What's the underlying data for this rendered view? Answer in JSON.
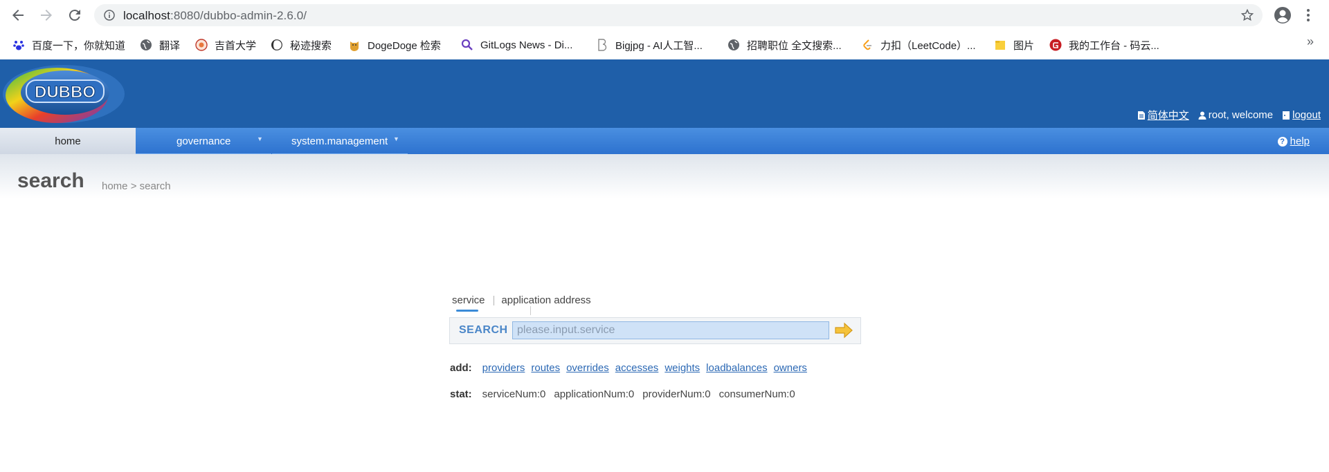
{
  "browser": {
    "url_host": "localhost",
    "url_path": ":8080/dubbo-admin-2.6.0/",
    "bookmarks": [
      {
        "label": "百度一下，你就知道",
        "icon": "baidu-paw-icon",
        "color": "#2932e1"
      },
      {
        "label": "翻译",
        "icon": "globe-icon",
        "color": "#5f6368"
      },
      {
        "label": "吉首大学",
        "icon": "university-seal-icon",
        "color": "#c0392b"
      },
      {
        "label": "秘迹搜索",
        "icon": "mijisou-icon",
        "color": "#333333"
      },
      {
        "label": "DogeDoge 检索",
        "icon": "doge-icon",
        "color": "#e0a030"
      },
      {
        "label": "GitLogs News - Di...",
        "icon": "magnifier-icon",
        "color": "#6a3fbf"
      },
      {
        "label": "Bigjpg - AI人工智...",
        "icon": "bigjpg-b-icon",
        "color": "#888888"
      },
      {
        "label": "招聘职位 全文搜索...",
        "icon": "globe-icon",
        "color": "#5f6368"
      },
      {
        "label": "力扣（LeetCode）...",
        "icon": "leetcode-icon",
        "color": "#f89f1b"
      },
      {
        "label": "图片",
        "icon": "folder-icon",
        "color": "#f9cf3b"
      },
      {
        "label": "我的工作台 - 码云...",
        "icon": "gitee-icon",
        "color": "#c71d23"
      }
    ],
    "more": "»"
  },
  "header": {
    "logo_text": "DUBBO",
    "language_link": "简体中文",
    "welcome_text": "root, welcome",
    "logout_link": "logout",
    "brand_color": "#1f5fa9"
  },
  "menu": {
    "home": "home",
    "governance": "governance",
    "system_management": "system.management",
    "help": "help"
  },
  "page": {
    "title": "search",
    "breadcrumb": "home > search"
  },
  "search": {
    "tabs": [
      "service",
      "application address"
    ],
    "active_tab": "service",
    "label": "SEARCH",
    "placeholder": "please.input.service",
    "value": ""
  },
  "add": {
    "label": "add:",
    "links": [
      "providers",
      "routes",
      "overrides",
      "accesses",
      "weights",
      "loadbalances",
      "owners"
    ]
  },
  "stat": {
    "label": "stat:",
    "items": [
      "serviceNum:0",
      "applicationNum:0",
      "providerNum:0",
      "consumerNum:0"
    ]
  }
}
